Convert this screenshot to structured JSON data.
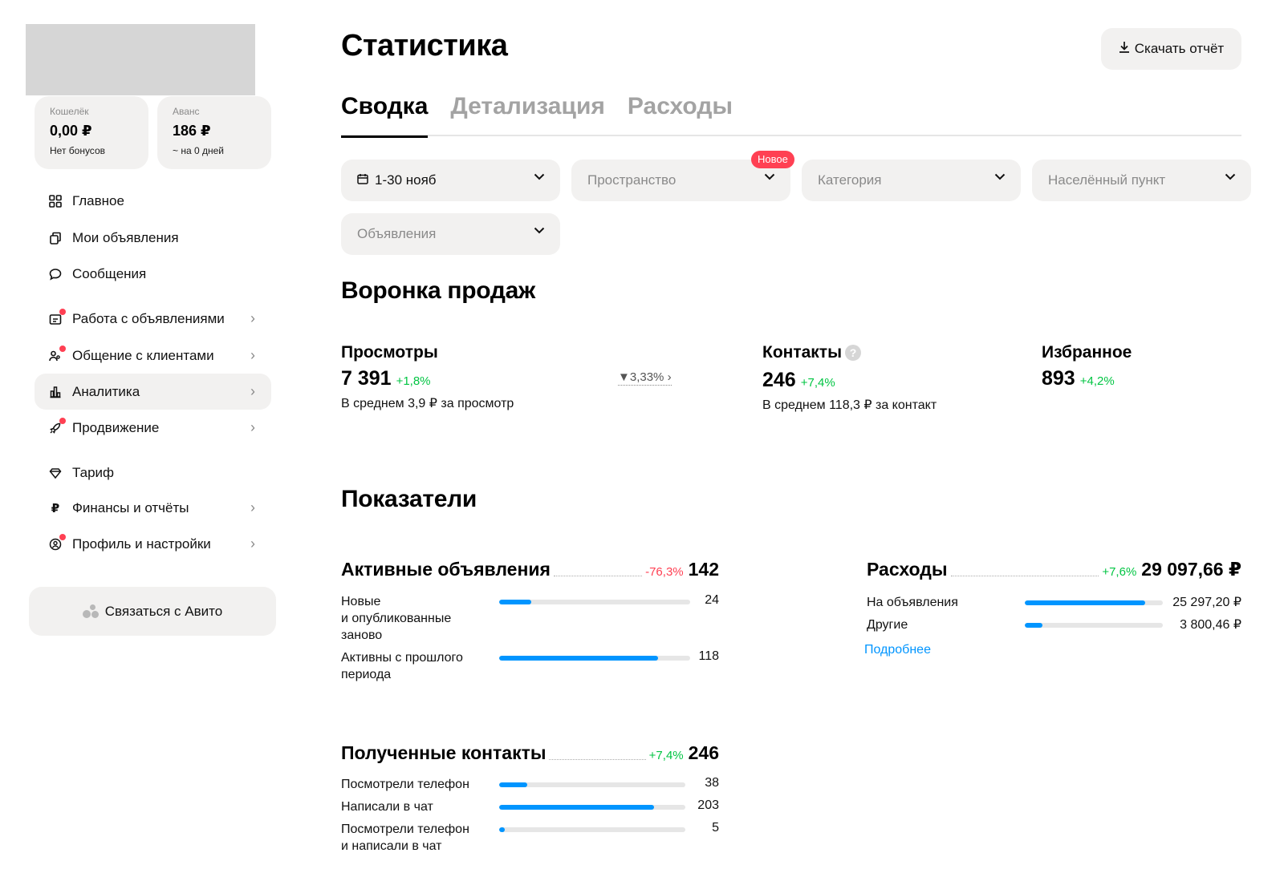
{
  "sidebar": {
    "wallet": {
      "label": "Кошелёк",
      "value": "0,00 ₽",
      "sub": "Нет бонусов"
    },
    "advance": {
      "label": "Аванс",
      "value": "186 ₽",
      "sub": "~ на 0 дней"
    },
    "nav": [
      {
        "label": "Главное",
        "icon": "grid-icon",
        "dot": false,
        "chevron": false,
        "active": false
      },
      {
        "label": "Мои объявления",
        "icon": "copy-icon",
        "dot": false,
        "chevron": false,
        "active": false
      },
      {
        "label": "Сообщения",
        "icon": "chat-icon",
        "dot": false,
        "chevron": false,
        "active": false
      },
      {
        "label": "Работа с объявлениями",
        "icon": "ads-work-icon",
        "dot": true,
        "chevron": true,
        "active": false
      },
      {
        "label": "Общение с клиентами",
        "icon": "people-icon",
        "dot": true,
        "chevron": true,
        "active": false
      },
      {
        "label": "Аналитика",
        "icon": "chart-icon",
        "dot": false,
        "chevron": true,
        "active": true
      },
      {
        "label": "Продвижение",
        "icon": "rocket-icon",
        "dot": true,
        "chevron": true,
        "active": false
      },
      {
        "label": "Тариф",
        "icon": "diamond-icon",
        "dot": false,
        "chevron": false,
        "active": false
      },
      {
        "label": "Финансы и отчёты",
        "icon": "ruble-icon",
        "dot": false,
        "chevron": true,
        "active": false
      },
      {
        "label": "Профиль и настройки",
        "icon": "profile-icon",
        "dot": true,
        "chevron": true,
        "active": false
      }
    ],
    "contact_button": "Связаться с Авито"
  },
  "header": {
    "title": "Статистика",
    "download_label": "Скачать отчёт"
  },
  "tabs": [
    {
      "label": "Сводка",
      "active": true
    },
    {
      "label": "Детализация",
      "active": false
    },
    {
      "label": "Расходы",
      "active": false
    }
  ],
  "filters": {
    "period": "1-30 нояб",
    "space": "Пространство",
    "space_badge": "Новое",
    "category": "Категория",
    "city": "Населённый пункт",
    "ads": "Объявления"
  },
  "funnel": {
    "title": "Воронка продаж",
    "views": {
      "title": "Просмотры",
      "value": "7 391",
      "delta": "+1,8%",
      "sub": "В среднем 3,9 ₽ за просмотр"
    },
    "conversion": "3,33%",
    "contacts": {
      "title": "Контакты",
      "value": "246",
      "delta": "+7,4%",
      "sub": "В среднем 118,3 ₽ за контакт"
    },
    "favorites": {
      "title": "Избранное",
      "value": "893",
      "delta": "+4,2%"
    }
  },
  "indicators": {
    "title": "Показатели",
    "active_ads": {
      "title": "Активные объявления",
      "delta": "-76,3%",
      "value": "142",
      "rows": [
        {
          "label": "Новые\nи опубликованные\nзаново",
          "value": "24",
          "fill": 0.17
        },
        {
          "label": "Активны с прошлого\nпериода",
          "value": "118",
          "fill": 0.83
        }
      ]
    },
    "expenses": {
      "title": "Расходы",
      "delta": "+7,6%",
      "value": "29 097,66 ₽",
      "rows": [
        {
          "label": "На объявления",
          "value": "25 297,20 ₽",
          "fill": 0.87
        },
        {
          "label": "Другие",
          "value": "3 800,46 ₽",
          "fill": 0.13
        }
      ],
      "more_link": "Подробнее"
    },
    "received_contacts": {
      "title": "Полученные контакты",
      "delta": "+7,4%",
      "value": "246",
      "rows": [
        {
          "label": "Посмотрели телефон",
          "value": "38",
          "fill": 0.15
        },
        {
          "label": "Написали в чат",
          "value": "203",
          "fill": 0.83
        },
        {
          "label": "Посмотрели телефон\nи написали в чат",
          "value": "5",
          "fill": 0.03
        }
      ]
    }
  },
  "colors": {
    "accent": "#0095ff",
    "positive": "#02c543",
    "negative": "#ff4053",
    "surface": "#f2f1f0"
  }
}
